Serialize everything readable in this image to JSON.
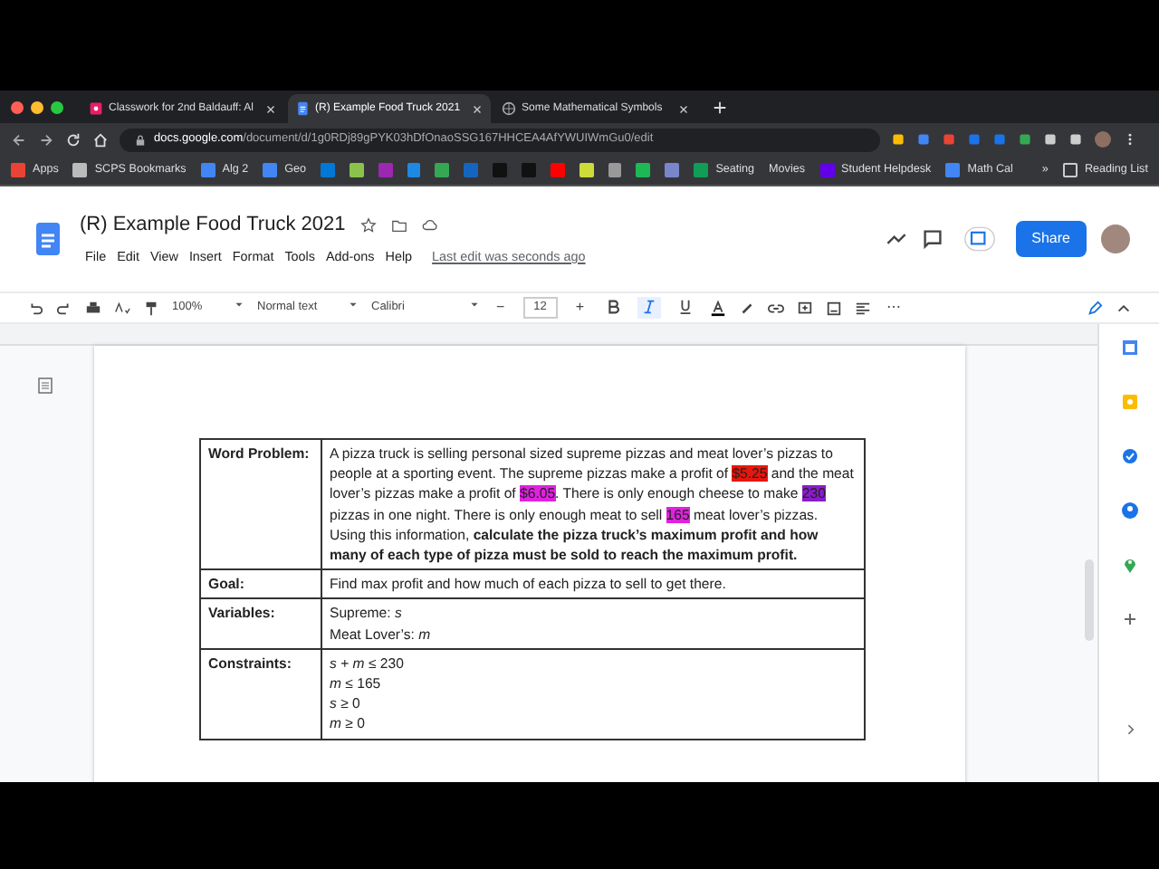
{
  "browser": {
    "tabs": [
      {
        "title": "Classwork for 2nd Baldauff: Al",
        "selected": false
      },
      {
        "title": "(R) Example Food Truck 2021",
        "selected": true
      },
      {
        "title": "Some Mathematical Symbols",
        "selected": false
      }
    ],
    "url_host": "docs.google.com",
    "url_path": "/document/d/1g0RDj89gPYK03hDfOnaoSSG167HHCEA4AfYWUIWmGu0/edit",
    "bookmarks": [
      {
        "label": "Apps",
        "kind": "apps"
      },
      {
        "label": "SCPS Bookmarks",
        "kind": "folder"
      },
      {
        "label": "Alg 2",
        "kind": "doc"
      },
      {
        "label": "Geo",
        "kind": "doc"
      },
      {
        "kind": "icons"
      },
      {
        "label": "Seating",
        "kind": "sheet"
      },
      {
        "label": "Movies",
        "kind": "plain"
      },
      {
        "label": "Student Helpdesk",
        "kind": "m"
      },
      {
        "label": "Math Cal",
        "kind": "doc"
      }
    ],
    "more": "»",
    "reading_list": "Reading List"
  },
  "document": {
    "title": "(R) Example Food Truck 2021",
    "menu": [
      "File",
      "Edit",
      "View",
      "Insert",
      "Format",
      "Tools",
      "Add-ons",
      "Help"
    ],
    "last_edit": "Last edit was seconds ago",
    "share": "Share"
  },
  "toolbar": {
    "zoom": "100%",
    "style": "Normal text",
    "font": "Calibri",
    "size": "12",
    "minus": "−",
    "plus": "+",
    "bold": false,
    "italic": true,
    "underline": false,
    "more": "⋯"
  },
  "table": [
    {
      "label": "Word Problem:",
      "kind": "segments",
      "segments": [
        {
          "text": "A pizza truck is selling personal sized supreme pizzas and meat lover’s pizzas to people at a sporting event. The supreme pizzas make a profit of "
        },
        {
          "text": "$5.25",
          "color": "#e8160c"
        },
        {
          "text": " and the meat lover’s pizzas make a profit of "
        },
        {
          "text": "$6.05",
          "color": "#e022e0"
        },
        {
          "text": ". There is only enough cheese to make "
        },
        {
          "text": "230",
          "color": "#8a1ccc"
        },
        {
          "text": " pizzas in one night. There is only enough meat to sell "
        },
        {
          "text": "165",
          "color": "#e022e0"
        },
        {
          "text": " meat lover’s pizzas. Using this information, "
        },
        {
          "text": "calculate the pizza truck’s maximum profit and how many of each type of pizza must be sold to reach the maximum profit.",
          "bold": true
        }
      ]
    },
    {
      "label": "Goal:",
      "kind": "lines",
      "lines": [
        "Find max profit and how much of each pizza to sell to get there."
      ]
    },
    {
      "label": "Variables:",
      "kind": "lines",
      "lines": [
        "Supreme: *s*",
        "Meat Lover’s: *m*"
      ]
    },
    {
      "label": "Constraints:",
      "kind": "lines",
      "lines": [
        "*s* + *m* ≤ 230",
        "*m* ≤ 165",
        "*s* ≥ 0",
        "*m* ≥ 0"
      ]
    }
  ]
}
